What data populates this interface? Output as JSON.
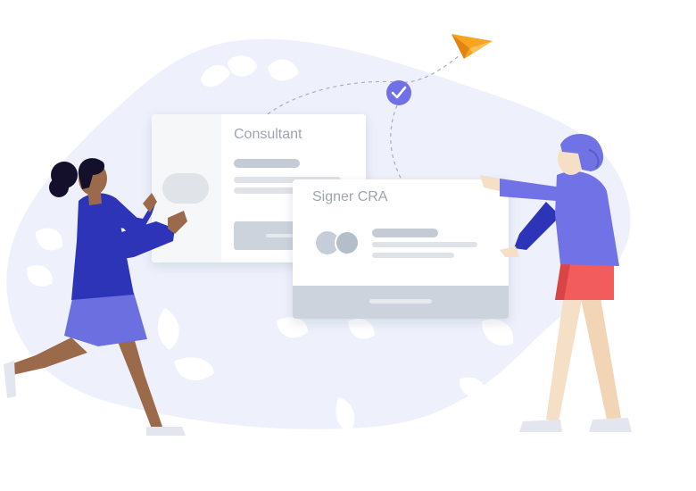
{
  "cards": {
    "consultant": {
      "title": "Consultant"
    },
    "signer": {
      "title": "Signer CRA"
    }
  },
  "icons": {
    "status": "check-circle-icon",
    "send": "paper-plane-icon"
  },
  "colors": {
    "blob": "#eef1fb",
    "accent": "#7070e8",
    "paper_plane": "#f8a420",
    "card_footer": "#cdd3dc",
    "placeholder_bar": "#c5cbd4",
    "woman_left_top": "#2e34b8",
    "woman_left_skirt": "#6b6fe0",
    "woman_right_top": "#7072e6",
    "woman_right_skirt": "#f25c5c"
  }
}
